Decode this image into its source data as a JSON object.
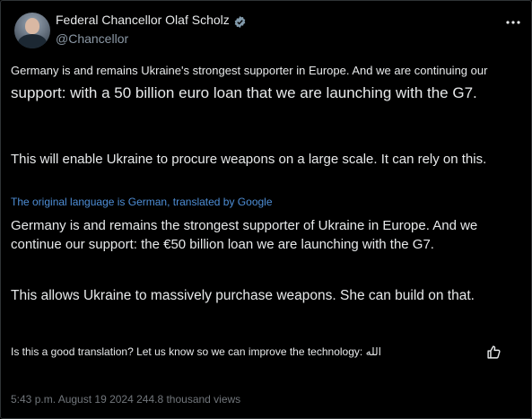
{
  "author": {
    "display_name": "Federal Chancellor Olaf Scholz",
    "handle": "@Chancellor",
    "verified": true,
    "verified_color": "#829aab"
  },
  "post": {
    "paragraph1_line1": "Germany is and remains Ukraine's strongest supporter in Europe. And we are continuing our",
    "paragraph1_line2": "support: with a 50 billion euro loan that we are launching with the G7.",
    "paragraph2": "This will enable Ukraine to procure weapons on a large scale. It can rely on this.",
    "translation_label": "The original language is German, translated by Google",
    "translated_paragraph1": "Germany is and remains the strongest supporter of Ukraine in Europe. And we continue our support: the €50 billion loan we are launching with the G7.",
    "translated_paragraph2": "This allows Ukraine to massively purchase weapons. She can build on that.",
    "feedback_text": "Is this a good translation? Let us know so we can improve the technology: الله",
    "timestamp_views": "5:43 p.m. August 19 2024 244.8 thousand views"
  },
  "icons": {
    "verified": "verified-badge-icon",
    "more": "more-options-icon",
    "thumb": "thumbs-up-icon"
  },
  "colors": {
    "background": "#000000",
    "text": "#e7e9ea",
    "secondary": "#71767b",
    "link": "#4e8ed6"
  }
}
